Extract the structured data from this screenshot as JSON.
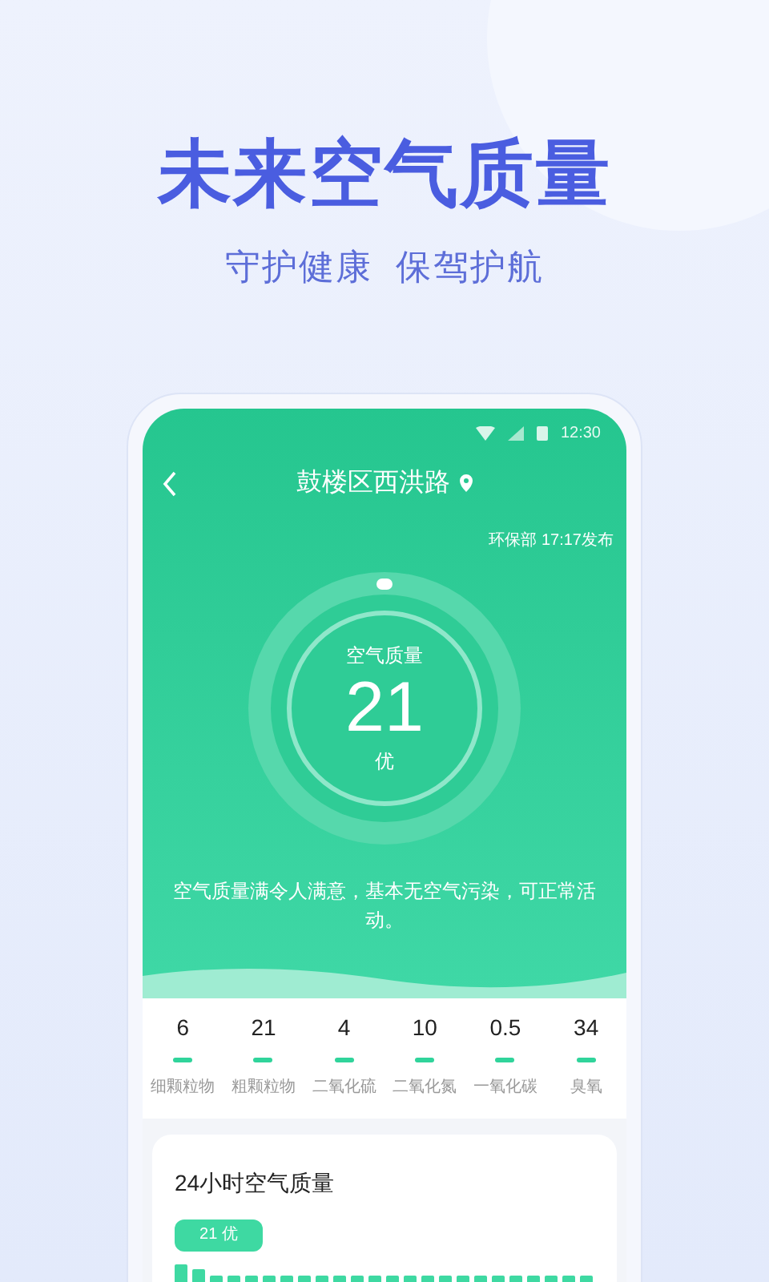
{
  "headline": "未来空气质量",
  "subtitle": "守护健康  保驾护航",
  "status_bar": {
    "time": "12:30"
  },
  "header": {
    "location": "鼓楼区西洪路",
    "publisher": "环保部 17:17发布"
  },
  "gauge": {
    "label": "空气质量",
    "value": "21",
    "grade": "优"
  },
  "description": "空气质量满令人满意，基本无空气污染，可正常活动。",
  "pollutants": [
    {
      "value": "6",
      "name": "细颗粒物"
    },
    {
      "value": "21",
      "name": "粗颗粒物"
    },
    {
      "value": "4",
      "name": "二氧化硫"
    },
    {
      "value": "10",
      "name": "二氧化氮"
    },
    {
      "value": "0.5",
      "name": "一氧化碳"
    },
    {
      "value": "34",
      "name": "臭氧"
    }
  ],
  "hourly": {
    "title": "24小时空气质量",
    "badge": "21 优"
  }
}
